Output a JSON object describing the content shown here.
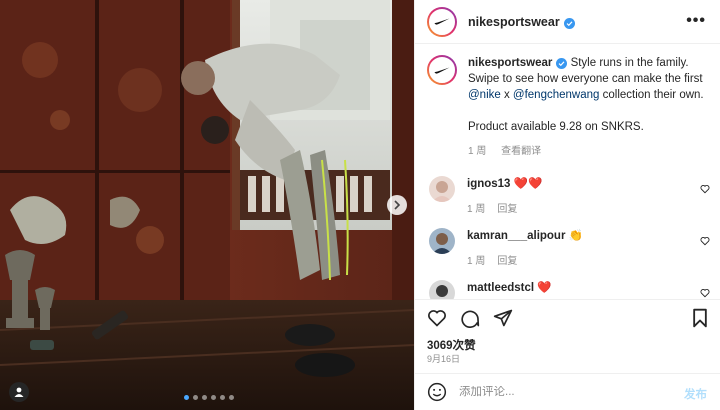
{
  "post": {
    "username": "nikesportswear",
    "more_label": "•••",
    "caption": {
      "username": "nikesportswear",
      "text_1": " Style runs in the family. Swipe to see how everyone can make the first ",
      "mention_1": "@nike",
      "text_2": " x ",
      "mention_2": "@fengchenwang",
      "text_3": " collection their own.",
      "text_4": "Product available 9.28 on SNKRS.",
      "time": "1 周",
      "translate": "查看翻译"
    },
    "comments": [
      {
        "username": "ignos13",
        "text": " ❤️❤️",
        "time": "1 周",
        "reply": "回复"
      },
      {
        "username": "kamran___alipour",
        "text": " 👏",
        "time": "1 周",
        "reply": "回复"
      },
      {
        "username": "mattleedstcl",
        "text": " ❤️",
        "time": "1 周",
        "reply": "回复"
      }
    ],
    "likes": "3069次赞",
    "date": "9月16日",
    "add_comment_placeholder": "添加评论...",
    "post_button": "发布",
    "carousel": {
      "count": 6,
      "active_index": 0
    }
  },
  "icons": {
    "header_verified": "verified-badge-icon",
    "like": "heart-icon",
    "comment": "comment-icon",
    "share": "send-icon",
    "save": "bookmark-icon",
    "emoji": "smiley-icon",
    "next": "chevron-right-icon",
    "tag": "user-tag-icon"
  },
  "colors": {
    "accent": "#3897f0",
    "link": "#00376b",
    "muted": "#8e8e8e",
    "heart_red": "#ed4956",
    "post_disabled": "#b2dffc"
  }
}
